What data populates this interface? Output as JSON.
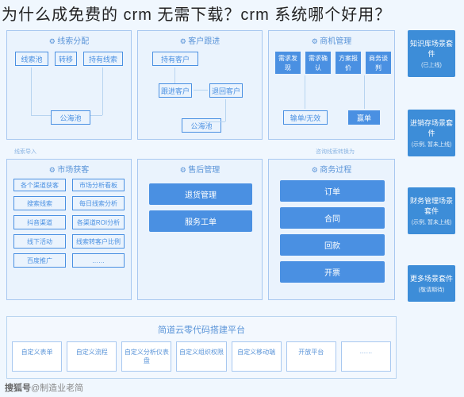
{
  "title": "为什么成免费的 crm 无需下载？crm 系统哪个好用？",
  "panels": {
    "p1": {
      "title": "线索分配",
      "a": "线索池",
      "b": "转移",
      "c": "持有线索",
      "d": "公海池",
      "m1": "线索导入"
    },
    "p2": {
      "title": "客户跟进",
      "a": "持有客户",
      "b": "跟进客户",
      "c": "退回客户",
      "d": "公海池"
    },
    "p3": {
      "title": "商机管理",
      "a": "需求发现",
      "b": "需求确认",
      "c": "方案报价",
      "d": "商务谈判",
      "e": "输单/无效",
      "f": "赢单",
      "m1": "咨询线索转换为"
    },
    "p4": {
      "title": "市场获客",
      "h1": "各个渠道获客",
      "h2": "市场分析看板",
      "l1": "搜索线索",
      "l2": "每日线索分析",
      "l3": "抖音渠道",
      "l4": "各渠道ROI分析",
      "l5": "线下活动",
      "l6": "线索转客户比例",
      "l7": "百度推广",
      "l8": "……"
    },
    "p5": {
      "title": "售后管理",
      "a": "退货管理",
      "b": "服务工单"
    },
    "p6": {
      "title": "商务过程",
      "a": "订单",
      "b": "合同",
      "c": "回款",
      "d": "开票"
    }
  },
  "right": [
    {
      "t": "知识库场景套件",
      "s": "(已上线)"
    },
    {
      "t": "进销存场景套件",
      "s": "(示例, 暂未上线)"
    },
    {
      "t": "财务管理场景套件",
      "s": "(示例, 暂未上线)"
    },
    {
      "t": "更多场景套件",
      "s": "(敬请期待)"
    }
  ],
  "bottom": {
    "title": "简道云零代码搭建平台",
    "items": [
      "自定义表单",
      "自定义流程",
      "自定义分析仪表盘",
      "自定义组织权限",
      "自定义移动端",
      "开放平台",
      "……"
    ]
  },
  "watermark": {
    "a": "搜狐号",
    "b": "@制造业老简"
  }
}
